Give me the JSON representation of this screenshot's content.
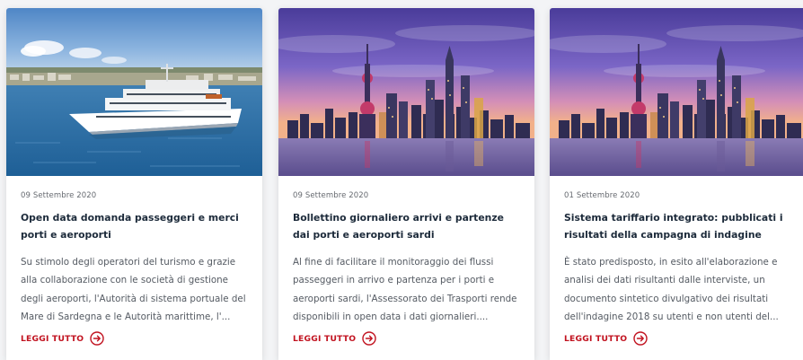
{
  "accent_color": "#c1121f",
  "cards": [
    {
      "image": "cruise-ship-photo",
      "date": "09 Settembre 2020",
      "title": "Open data domanda passeggeri e merci porti e aeroporti",
      "excerpt": "Su stimolo degli operatori del turismo e grazie alla collaborazione con le società di gestione degli aeroporti, l'Autorità di sistema portuale del Mare di Sardegna e le Autorità marittime, l'...",
      "read_more": "LEGGI TUTTO",
      "read_more_icon": "arrow-right-circle-icon"
    },
    {
      "image": "city-skyline-photo",
      "date": "09 Settembre 2020",
      "title": "Bollettino giornaliero arrivi e partenze dai porti e aeroporti sardi",
      "excerpt": "Al fine di facilitare il monitoraggio dei flussi passeggeri in arrivo e partenza per i porti e aeroporti sardi, l'Assessorato dei Trasporti rende disponibili in open data i dati giornalieri....",
      "read_more": "LEGGI TUTTO",
      "read_more_icon": "arrow-right-circle-icon"
    },
    {
      "image": "city-skyline-photo",
      "date": "01 Settembre 2020",
      "title": "Sistema tariffario integrato: pubblicati i risultati della campagna di indagine",
      "excerpt": "È stato predisposto, in esito all'elaborazione e analisi dei dati risultanti dalle interviste, un documento sintetico divulgativo dei risultati dell'indagine 2018 su utenti e non utenti del...",
      "read_more": "LEGGI TUTTO",
      "read_more_icon": "arrow-right-circle-icon"
    }
  ]
}
